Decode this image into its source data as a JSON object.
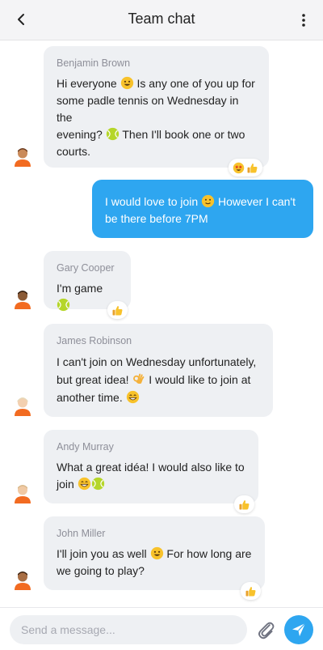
{
  "header": {
    "title": "Team chat",
    "back_icon": "chevron-left-icon",
    "menu_icon": "more-vertical-icon"
  },
  "messages": [
    {
      "sender": "Benjamin Brown",
      "lines": [
        "Hi everyone ",
        " Is any one of you up for",
        "some padle tennis on Wednesday in the",
        "evening? ",
        " Then I'll book one or two",
        "courts."
      ],
      "reactions": [
        "star-struck-emoji",
        "thumbs-up-emoji"
      ]
    },
    {
      "sender": "",
      "lines": [
        "I would love to join ",
        " However I can't",
        "be there before 7PM"
      ],
      "reactions": []
    },
    {
      "sender": "Gary Cooper",
      "lines": [
        "I'm game "
      ],
      "reactions": [
        "thumbs-up-emoji"
      ]
    },
    {
      "sender": "James Robinson",
      "lines": [
        "I can't join on Wednesday unfortunately,",
        "but great idea! ",
        " I would like to join at",
        "another time. "
      ],
      "reactions": []
    },
    {
      "sender": "Andy Murray",
      "lines": [
        "What a great idéa! I would also like to",
        "join "
      ],
      "reactions": [
        "thumbs-up-emoji"
      ]
    },
    {
      "sender": "John Miller",
      "lines": [
        "I'll join you as well ",
        " For how long are",
        "we going to play?"
      ],
      "reactions": [
        "thumbs-up-emoji"
      ]
    }
  ],
  "composer": {
    "placeholder": "Send a message...",
    "attach_icon": "paperclip-icon",
    "send_icon": "send-icon"
  },
  "colors": {
    "accent": "#2ea6f0",
    "bubble_in": "#eef0f3",
    "sender_name": "#8e8f99",
    "avatar_shirt": "#f26b21"
  }
}
